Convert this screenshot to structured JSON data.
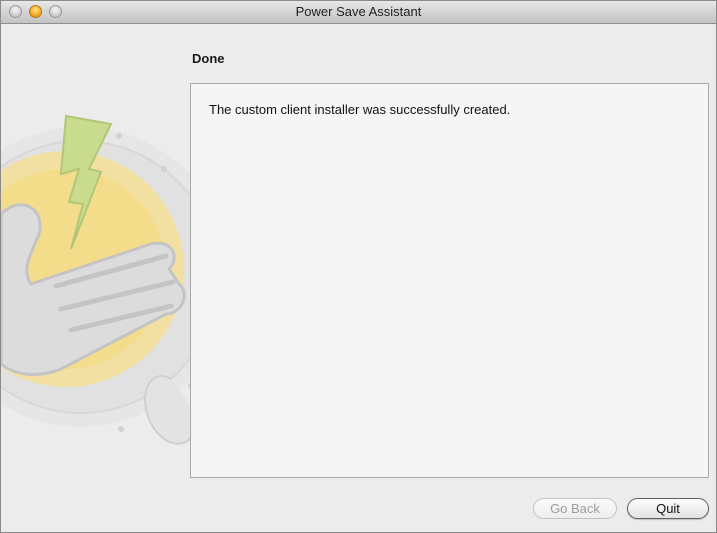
{
  "window": {
    "title": "Power Save Assistant"
  },
  "step": {
    "heading": "Done"
  },
  "content": {
    "message": "The custom client installer was successfully created."
  },
  "buttons": {
    "go_back": "Go Back",
    "quit": "Quit"
  },
  "colors": {
    "window_background": "#ececec",
    "panel_background": "#f5f5f5",
    "bolt_green": "#c9db8c",
    "sun_yellow": "#f3dc82",
    "minimize_orange": "#f3a41a"
  },
  "icons": {
    "artwork": "power-save-hand-bolt-icon"
  }
}
